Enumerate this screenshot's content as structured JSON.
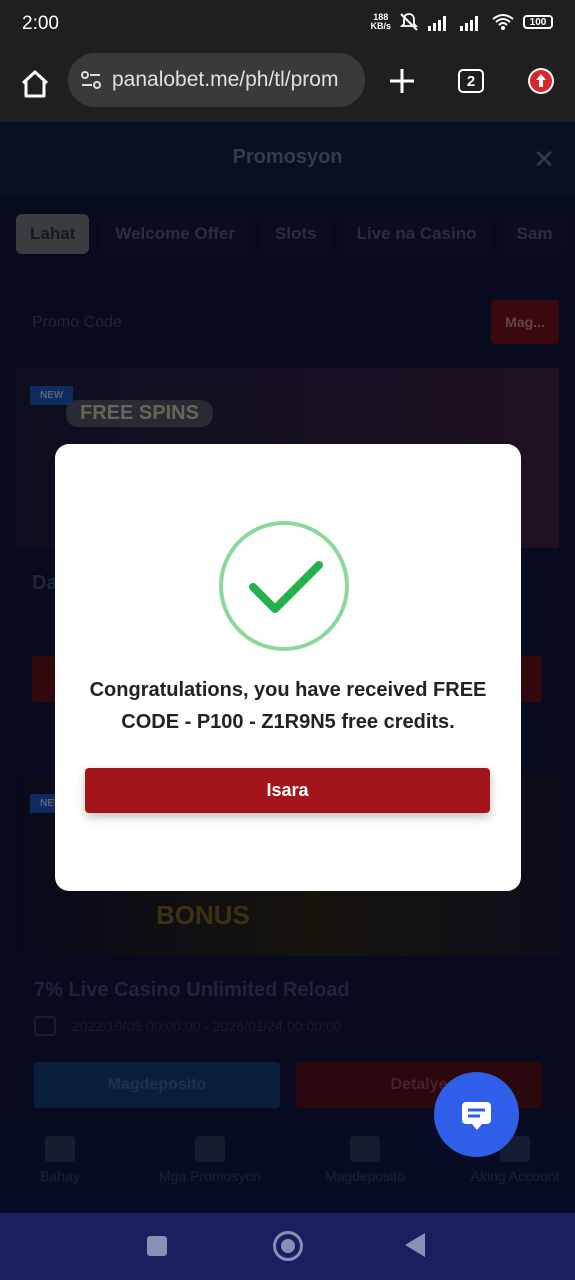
{
  "status_bar": {
    "time": "2:00",
    "net_speed_value": "188",
    "net_speed_unit": "KB/s",
    "battery": "100"
  },
  "browser": {
    "url": "panalobet.me/ph/tl/prom",
    "tab_count": "2"
  },
  "page": {
    "header_title": "Promosyon",
    "close_glyph": "✕",
    "tabs": [
      "Lahat",
      "Welcome Offer",
      "Slots",
      "Live na Casino",
      "Sam"
    ],
    "promo_code_label": "Promo Code",
    "promo_code_button": "Mag...",
    "promos": [
      {
        "badge": "NEW",
        "banner_text": "FREE SPINS",
        "title": "Da..."
      },
      {
        "badge": "NEW",
        "banner_text": "BONUS",
        "title": "7% Live Casino Unlimited Reload",
        "date": "2022/10/09 00:00:00 - 2026/01/24 00:00:00",
        "deposit_label": "Magdeposito",
        "details_label": "Detalye"
      }
    ]
  },
  "bottom_nav": [
    {
      "label": "Bahay"
    },
    {
      "label": "Mga Promosyon"
    },
    {
      "label": "Magdeposito"
    },
    {
      "label": "Aking Account"
    }
  ],
  "modal": {
    "message": "Congratulations, you have received FREE CODE - P100 - Z1R9N5 free credits.",
    "close_button": "Isara"
  },
  "colors": {
    "modal_button": "#a3141b",
    "check_green": "#22b14c",
    "chat_fab": "#2f5fe8"
  }
}
